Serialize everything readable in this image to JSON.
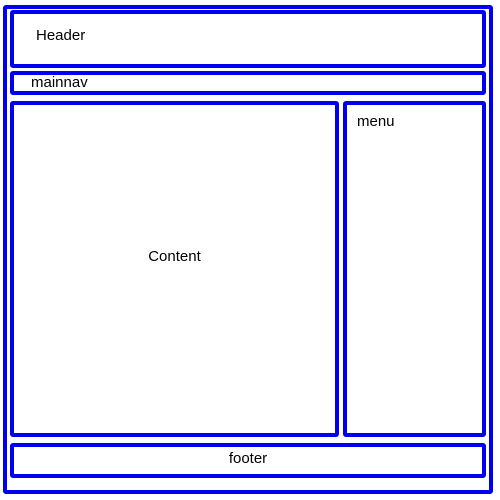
{
  "layout": {
    "header_label": "Header",
    "nav_label": "mainnav",
    "content_label": "Content",
    "menu_label": "menu",
    "footer_label": "footer"
  },
  "colors": {
    "border": "#0000ee",
    "background": "#ffffff",
    "text": "#000000"
  }
}
